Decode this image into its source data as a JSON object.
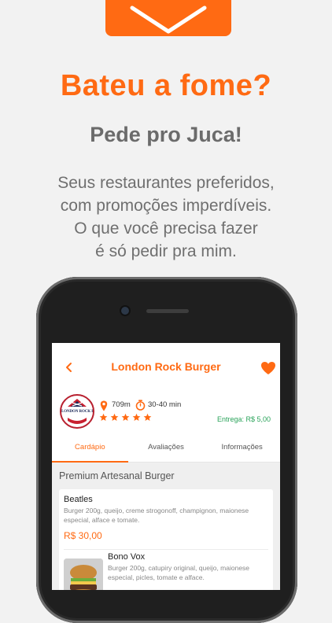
{
  "promo": {
    "headline": "Bateu a fome?",
    "subheadline": "Pede pro Juca!",
    "description_lines": [
      "Seus restaurantes preferidos,",
      "com promoções imperdíveis.",
      "O que você precisa fazer",
      "é só pedir pra mim."
    ]
  },
  "colors": {
    "accent": "#ff6a13",
    "text_gray": "#6f6f6f",
    "delivery_green": "#2aa35a",
    "background": "#f2f2f2"
  },
  "app": {
    "header": {
      "title": "London Rock Burger",
      "back_icon": "chevron-left-icon",
      "favorite_icon": "heart-icon"
    },
    "restaurant": {
      "logo_text": "LONDON ROCK BURGER",
      "distance": "709m",
      "eta": "30-40 min",
      "rating": 5,
      "rating_max": 5,
      "delivery_fee": "Entrega: R$ 5,00"
    },
    "tabs": [
      {
        "label": "Cardápio",
        "active": true
      },
      {
        "label": "Avaliações",
        "active": false
      },
      {
        "label": "Informações",
        "active": false
      }
    ],
    "menu": {
      "section_title": "Premium Artesanal Burger",
      "items": [
        {
          "name": "Beatles",
          "description": "Burger 200g, queijo, creme strogonoff, champignon, maionese especial, alface e tomate.",
          "price": "R$ 30,00"
        },
        {
          "name": "Bono Vox",
          "description": "Burger 200g, catupiry original, queijo, maionese especial, picles, tomate e alface."
        }
      ]
    }
  }
}
